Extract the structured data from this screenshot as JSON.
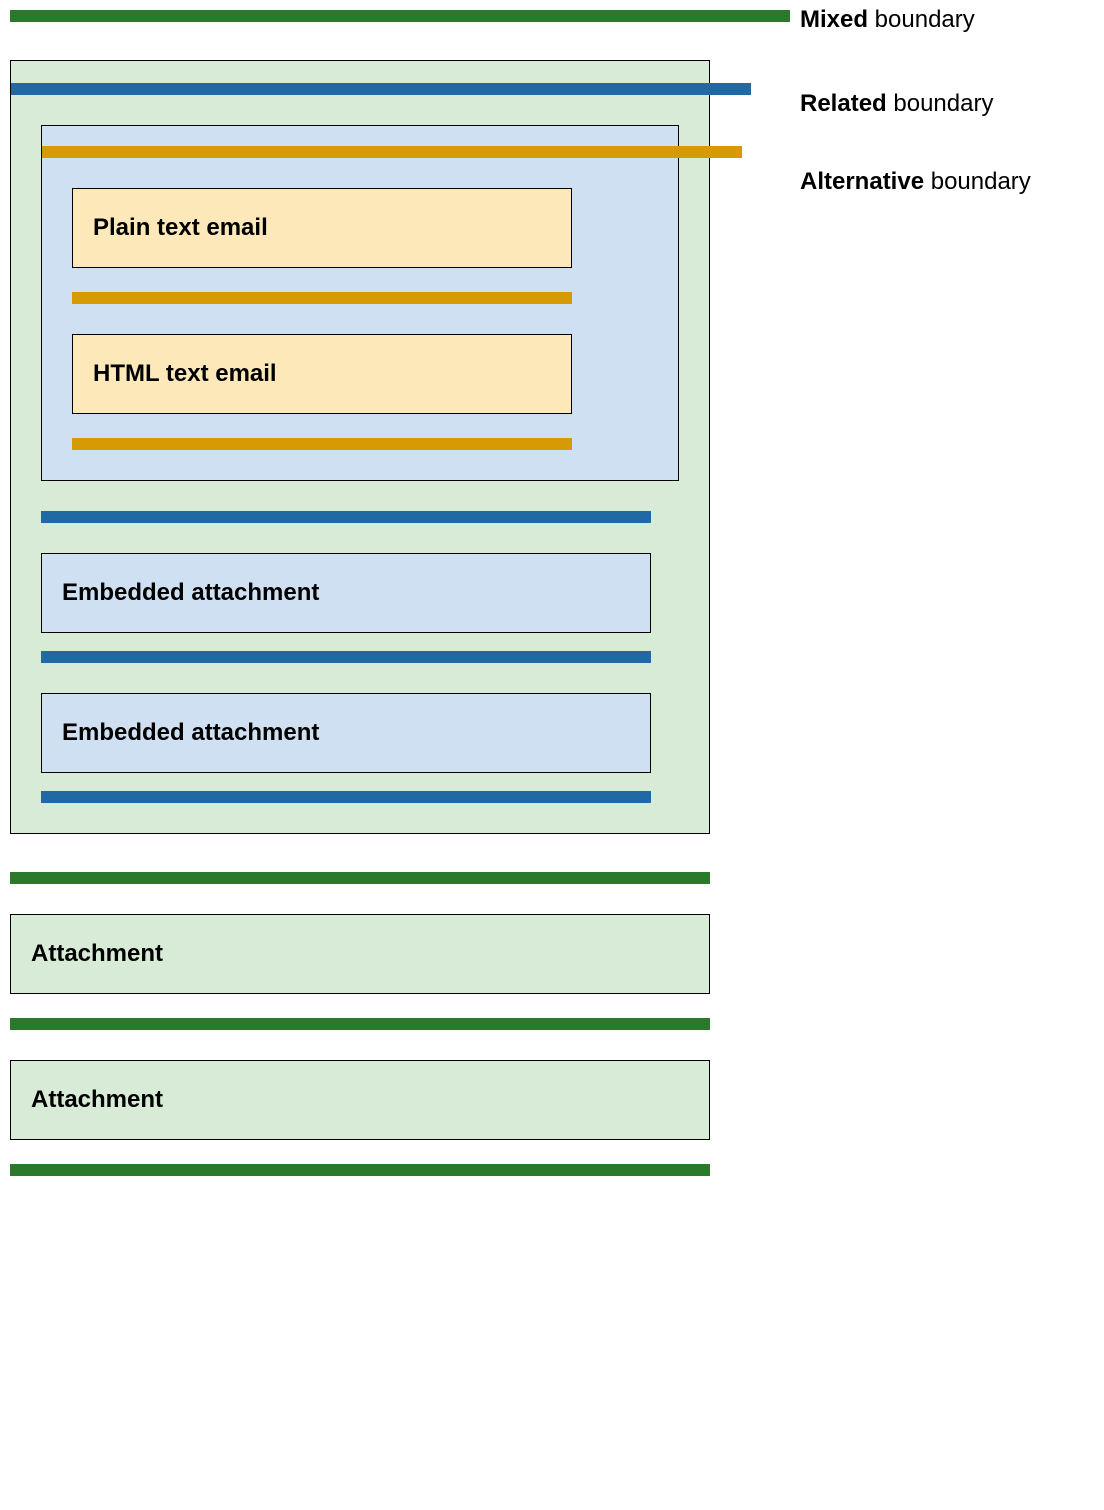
{
  "legend": {
    "mixed_bold": "Mixed",
    "mixed_rest": " boundary",
    "related_bold": "Related",
    "related_rest": " boundary",
    "alternative_bold": "Alternative",
    "alternative_rest": " boundary"
  },
  "labels": {
    "plain_text": "Plain text email",
    "html_text": "HTML text email",
    "embedded_1": "Embedded attachment",
    "embedded_2": "Embedded attachment",
    "attachment_1": "Attachment",
    "attachment_2": "Attachment"
  },
  "colors": {
    "green": "#2b7a2b",
    "blue": "#1f6aa5",
    "yellow": "#d69a05",
    "box_green": "#d7ebd7",
    "box_blue": "#cfe0f2",
    "box_cream": "#fce8b8"
  }
}
